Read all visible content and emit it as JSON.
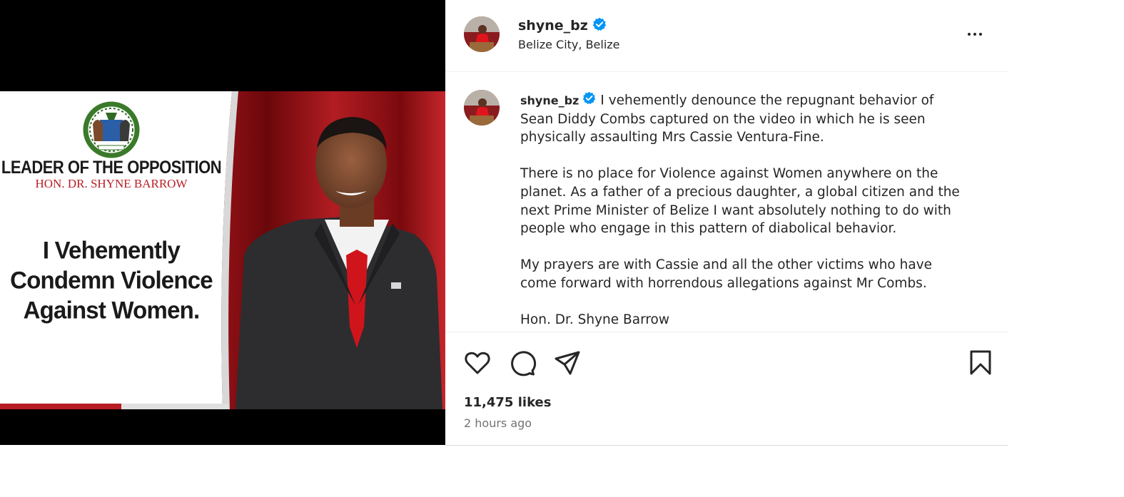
{
  "post": {
    "image": {
      "opposition_title": "LEADER OF THE OPPOSITION",
      "opposition_name": "HON. DR. SHYNE BARROW",
      "headline_lines": [
        "I Vehemently",
        "Condemn Violence",
        "Against Women."
      ]
    },
    "header": {
      "username": "shyne_bz",
      "location": "Belize City, Belize",
      "avatar_icon": "profile-avatar",
      "verified_icon": "verified-badge-icon",
      "more_icon": "more-options-icon"
    },
    "caption": {
      "username": "shyne_bz",
      "paragraphs": [
        "I vehemently denounce the repugnant behavior of Sean Diddy Combs captured on the video in which he is seen physically assaulting Mrs Cassie Ventura-Fine.",
        "There is no place for Violence against Women anywhere on the planet. As a father of a precious daughter, a global citizen and the next Prime Minister of Belize I want absolutely nothing to do with people who engage in this pattern of diabolical behavior.",
        "My prayers are with Cassie and all the other victims who have come forward with horrendous allegations against Mr Combs.",
        "Hon. Dr. Shyne Barrow"
      ]
    },
    "actions": {
      "like_icon": "heart-icon",
      "comment_icon": "comment-icon",
      "share_icon": "share-icon",
      "save_icon": "bookmark-icon"
    },
    "likes": "11,475 likes",
    "time": "2 hours ago",
    "colors": {
      "verified": "#0095f6",
      "accent_red": "#b81d24",
      "curtain": "#8b0d12"
    }
  }
}
